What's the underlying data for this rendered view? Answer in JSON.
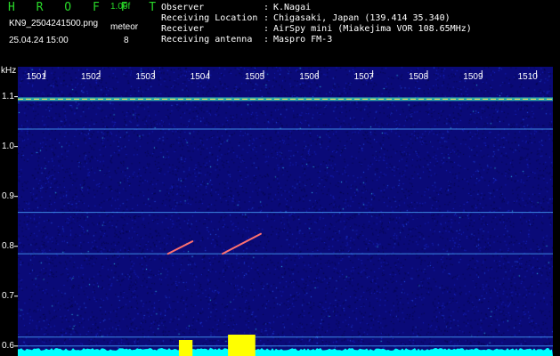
{
  "header": {
    "brand": "H R O F F T",
    "version": "1.00f",
    "filename": "KN9_2504241500.png",
    "datetime": "25.04.24 15:00",
    "meteor_label": "meteor",
    "meteor_count": "8",
    "info": [
      {
        "label": "Observer",
        "value": "K.Nagai"
      },
      {
        "label": "Receiving Location",
        "value": "Chigasaki, Japan (139.414 35.340)"
      },
      {
        "label": "Receiver",
        "value": "AirSpy mini (Miakejima VOR 108.65MHz)"
      },
      {
        "label": "Receiving antenna",
        "value": "Maspro FM-3"
      }
    ]
  },
  "colors": {
    "background": "#000000",
    "plot_background": "#0a0a78",
    "brand": "#29d829",
    "trace": "#00ffff",
    "burst": "#ffff00"
  },
  "chart_data": {
    "type": "heatmap",
    "ylabel": "kHz",
    "y_ticks": [
      "1.1",
      "1.0",
      "0.9",
      "0.8",
      "0.7",
      "0.6"
    ],
    "x_ticks": [
      "1501",
      "1502",
      "1503",
      "1504",
      "1505",
      "1506",
      "1507",
      "1508",
      "1509",
      "1510"
    ],
    "ylim": [
      0.58,
      1.16
    ],
    "xlim": [
      1500.5,
      1510.3
    ],
    "signals": [
      {
        "kind": "carrier",
        "freq_khz": 1.095
      },
      {
        "kind": "line",
        "freq_khz": 1.035
      },
      {
        "kind": "line",
        "freq_khz": 0.868
      },
      {
        "kind": "line",
        "freq_khz": 0.785
      },
      {
        "kind": "line",
        "freq_khz": 0.618
      },
      {
        "kind": "line",
        "freq_khz": 0.6
      }
    ],
    "meteor_echoes": [
      {
        "t_start": 1503.25,
        "t_end": 1503.7,
        "f_start": 0.785,
        "f_end": 0.81
      },
      {
        "t_start": 1504.25,
        "t_end": 1504.95,
        "f_start": 0.785,
        "f_end": 0.825
      }
    ],
    "bursts": [
      {
        "t_start": 1503.45,
        "t_end": 1503.7,
        "level": 0.45
      },
      {
        "t_start": 1504.35,
        "t_end": 1504.85,
        "level": 0.6
      }
    ]
  }
}
